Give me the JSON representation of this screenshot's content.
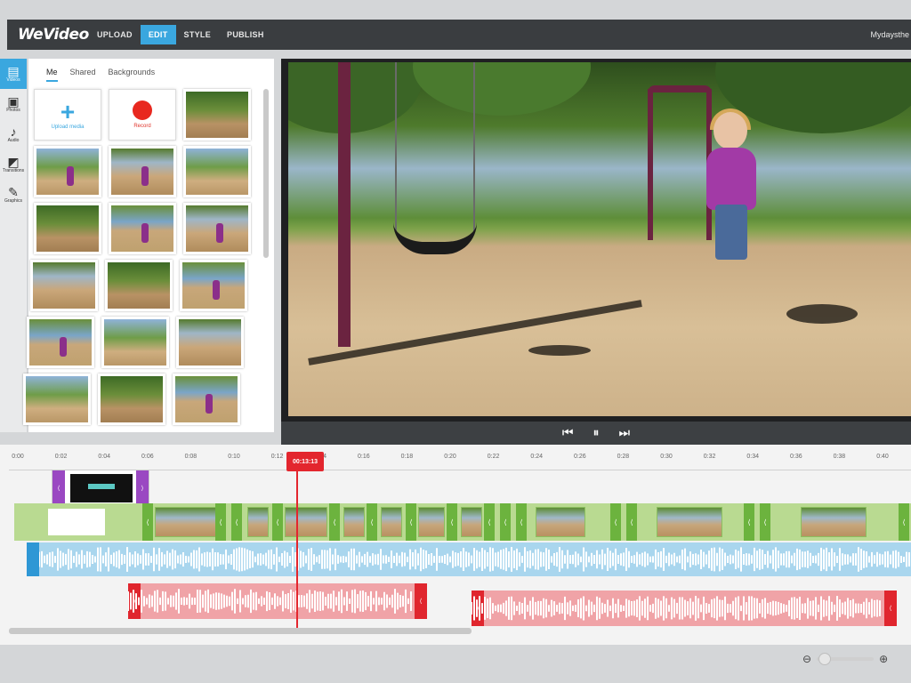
{
  "app": {
    "logo": "WeVideo",
    "nav": [
      {
        "label": "UPLOAD",
        "active": false
      },
      {
        "label": "EDIT",
        "active": true
      },
      {
        "label": "STYLE",
        "active": false
      },
      {
        "label": "PUBLISH",
        "active": false
      }
    ],
    "project_title": "Mydaysthe"
  },
  "rail": {
    "items": [
      {
        "label": "Videos",
        "icon": "film-icon"
      },
      {
        "label": "Photos",
        "icon": "image-icon"
      },
      {
        "label": "Audio",
        "icon": "music-icon"
      },
      {
        "label": "Transitions",
        "icon": "transition-icon"
      },
      {
        "label": "Graphics",
        "icon": "graphics-icon"
      }
    ]
  },
  "media": {
    "tabs": [
      "Me",
      "Shared",
      "Backgrounds"
    ],
    "active_tab": "Me",
    "upload_label": "Upload media",
    "record_label": "Record"
  },
  "player": {
    "prev_label": "⏮",
    "pause_label": "⏸",
    "next_label": "⏭"
  },
  "timeline": {
    "ticks": [
      "0:00",
      "0:02",
      "0:04",
      "0:06",
      "0:08",
      "0:10",
      "0:12",
      "0:14",
      "0:16",
      "0:18",
      "0:20",
      "0:22",
      "0:24",
      "0:26",
      "0:28",
      "0:30",
      "0:32",
      "0:34",
      "0:36",
      "0:38",
      "0:40"
    ],
    "playhead_time": "00:13:13"
  },
  "zoom": {
    "out_icon": "zoom-out-icon",
    "in_icon": "zoom-in-icon"
  },
  "colors": {
    "accent": "#3aa7df",
    "playhead": "#e3262e",
    "video_track": "#b9da91",
    "audio_track": "#a9d6ee",
    "voice_track": "#f0a3a7"
  }
}
